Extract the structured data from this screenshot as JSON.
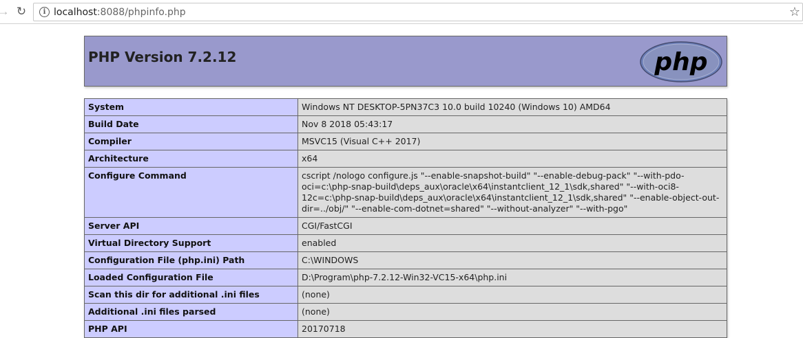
{
  "browser": {
    "url_host": "localhost",
    "url_rest": ":8088/phpinfo.php"
  },
  "header": {
    "title": "PHP Version 7.2.12",
    "logo_text": "php"
  },
  "rows": [
    {
      "key": "System",
      "value": "Windows NT DESKTOP-5PN37C3 10.0 build 10240 (Windows 10) AMD64"
    },
    {
      "key": "Build Date",
      "value": "Nov 8 2018 05:43:17"
    },
    {
      "key": "Compiler",
      "value": "MSVC15 (Visual C++ 2017)"
    },
    {
      "key": "Architecture",
      "value": "x64"
    },
    {
      "key": "Configure Command",
      "value": "cscript /nologo configure.js \"--enable-snapshot-build\" \"--enable-debug-pack\" \"--with-pdo-oci=c:\\php-snap-build\\deps_aux\\oracle\\x64\\instantclient_12_1\\sdk,shared\" \"--with-oci8-12c=c:\\php-snap-build\\deps_aux\\oracle\\x64\\instantclient_12_1\\sdk,shared\" \"--enable-object-out-dir=../obj/\" \"--enable-com-dotnet=shared\" \"--without-analyzer\" \"--with-pgo\""
    },
    {
      "key": "Server API",
      "value": "CGI/FastCGI"
    },
    {
      "key": "Virtual Directory Support",
      "value": "enabled"
    },
    {
      "key": "Configuration File (php.ini) Path",
      "value": "C:\\WINDOWS"
    },
    {
      "key": "Loaded Configuration File",
      "value": "D:\\Program\\php-7.2.12-Win32-VC15-x64\\php.ini"
    },
    {
      "key": "Scan this dir for additional .ini files",
      "value": "(none)"
    },
    {
      "key": "Additional .ini files parsed",
      "value": "(none)"
    },
    {
      "key": "PHP API",
      "value": "20170718"
    }
  ],
  "colors": {
    "header_bg": "#9999cc",
    "key_bg": "#ccccff",
    "value_bg": "#dddddd"
  }
}
